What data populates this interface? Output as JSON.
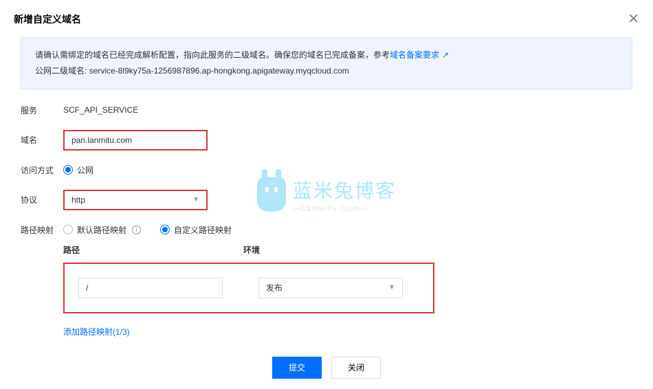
{
  "modal": {
    "title": "新增自定义域名"
  },
  "info": {
    "line1_prefix": "请确认需绑定的域名已经完成解析配置，指向此服务的二级域名。确保您的域名已完成备案，参考",
    "link_text": "域名备案要求",
    "line2_label": "公网二级域名: ",
    "line2_value": "service-8l9ky75a-1256987896.ap-hongkong.apigateway.myqcloud.com"
  },
  "form": {
    "service_label": "服务",
    "service_value": "SCF_API_SERVICE",
    "domain_label": "域名",
    "domain_value": "pan.lanmitu.com",
    "access_label": "访问方式",
    "access_value": "公网",
    "protocol_label": "协议",
    "protocol_value": "http",
    "mapping_label": "路径映射",
    "mapping_default": "默认路径映射",
    "mapping_custom": "自定义路径映射"
  },
  "mapping": {
    "path_header": "路径",
    "env_header": "环境",
    "path_value": "/",
    "env_value": "发布",
    "add_link": "添加路径映射(1/3)"
  },
  "footer": {
    "submit": "提交",
    "cancel": "关闭"
  },
  "watermark": {
    "top": "蓝米兔博客",
    "bot": "—LanMiTu.Com—"
  }
}
